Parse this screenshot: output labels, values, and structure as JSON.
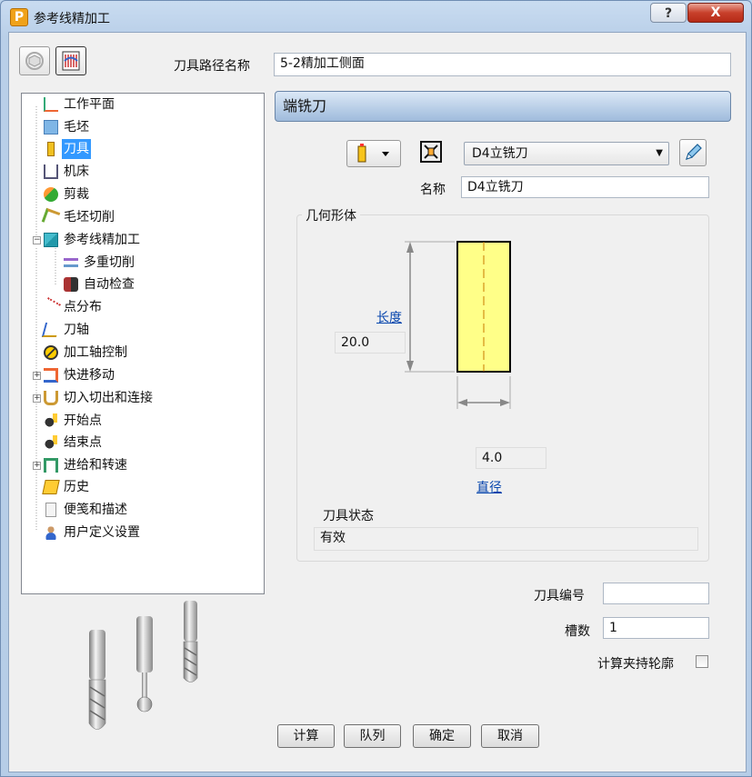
{
  "window": {
    "title": "参考线精加工",
    "help_label": "?",
    "close_label": "X"
  },
  "toolpath_name": {
    "label": "刀具路径名称",
    "value": "5-2精加工侧面"
  },
  "tree": {
    "items": [
      {
        "label": "工作平面"
      },
      {
        "label": "毛坯"
      },
      {
        "label": "刀具"
      },
      {
        "label": "机床"
      },
      {
        "label": "剪裁"
      },
      {
        "label": "毛坯切削"
      },
      {
        "label": "参考线精加工"
      },
      {
        "label": "多重切削"
      },
      {
        "label": "自动检查"
      },
      {
        "label": "点分布"
      },
      {
        "label": "刀轴"
      },
      {
        "label": "加工轴控制"
      },
      {
        "label": "快进移动"
      },
      {
        "label": "切入切出和连接"
      },
      {
        "label": "开始点"
      },
      {
        "label": "结束点"
      },
      {
        "label": "进给和转速"
      },
      {
        "label": "历史"
      },
      {
        "label": "便笺和描述"
      },
      {
        "label": "用户定义设置"
      }
    ]
  },
  "panel": {
    "header": "端铣刀",
    "tool_select": "D4立铣刀",
    "name_label": "名称",
    "name_value": "D4立铣刀",
    "geometry_title": "几何形体",
    "length_link": "长度",
    "length_value": "20.0",
    "diameter_value": "4.0",
    "diameter_link": "直径",
    "tool_status_label": "刀具状态",
    "tool_status_value": "有效",
    "tool_number_label": "刀具编号",
    "tool_number_value": "",
    "flutes_label": "槽数",
    "flutes_value": "1",
    "holder_profile_label": "计算夹持轮廓"
  },
  "buttons": {
    "calculate": "计算",
    "queue": "队列",
    "ok": "确定",
    "cancel": "取消"
  },
  "colors": {
    "selected": "#3399ff",
    "tool_body": "#ffff88",
    "header_gradient_top": "#dbe8f6"
  }
}
